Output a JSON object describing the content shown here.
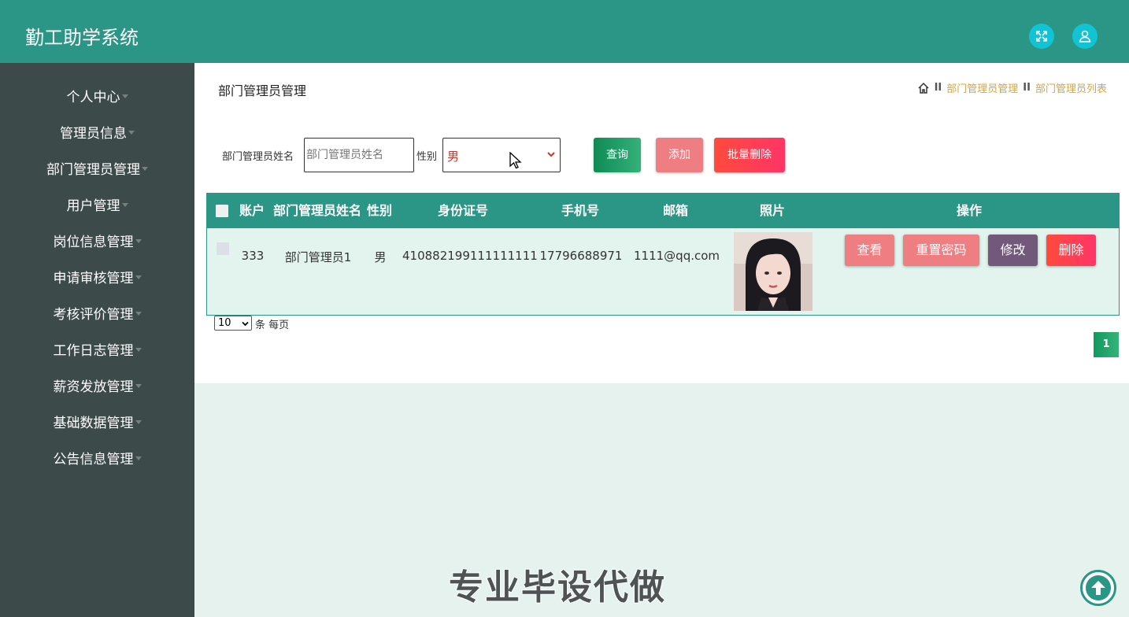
{
  "app": {
    "title": "勤工助学系统"
  },
  "topbar": {
    "fullscreen_icon": "expand-icon",
    "user_icon": "user-icon"
  },
  "sidebar": {
    "items": [
      {
        "label": "个人中心"
      },
      {
        "label": "管理员信息"
      },
      {
        "label": "部门管理员管理"
      },
      {
        "label": "用户管理"
      },
      {
        "label": "岗位信息管理"
      },
      {
        "label": "申请审核管理"
      },
      {
        "label": "考核评价管理"
      },
      {
        "label": "工作日志管理"
      },
      {
        "label": "薪资发放管理"
      },
      {
        "label": "基础数据管理"
      },
      {
        "label": "公告信息管理"
      }
    ]
  },
  "page": {
    "title": "部门管理员管理",
    "breadcrumb": {
      "sep": "II",
      "items": [
        "部门管理员管理",
        "部门管理员列表"
      ]
    }
  },
  "search": {
    "name_label": "部门管理员姓名",
    "name_placeholder": "部门管理员姓名",
    "gender_label": "性别",
    "gender_value": "男",
    "query_button": "查询",
    "add_button": "添加",
    "batch_delete_button": "批量删除"
  },
  "table": {
    "headers": [
      "账户",
      "部门管理员姓名",
      "性别",
      "身份证号",
      "手机号",
      "邮箱",
      "照片",
      "操作"
    ],
    "rows": [
      {
        "account": "333",
        "name": "部门管理员1",
        "gender": "男",
        "id_card": "410882199111111111",
        "phone": "17796688971",
        "email": "1111@qq.com",
        "actions": {
          "view": "查看",
          "reset": "重置密码",
          "edit": "修改",
          "delete": "删除"
        }
      }
    ]
  },
  "pagination": {
    "page_size": "10",
    "page_size_label": "条 每页",
    "current_page": "1"
  },
  "watermark": "专业毕设代做",
  "colors": {
    "primary": "#2b9586",
    "sidebar": "#3d4a4a",
    "background": "#e6f2ed",
    "accent_gold": "#d9a43a"
  }
}
